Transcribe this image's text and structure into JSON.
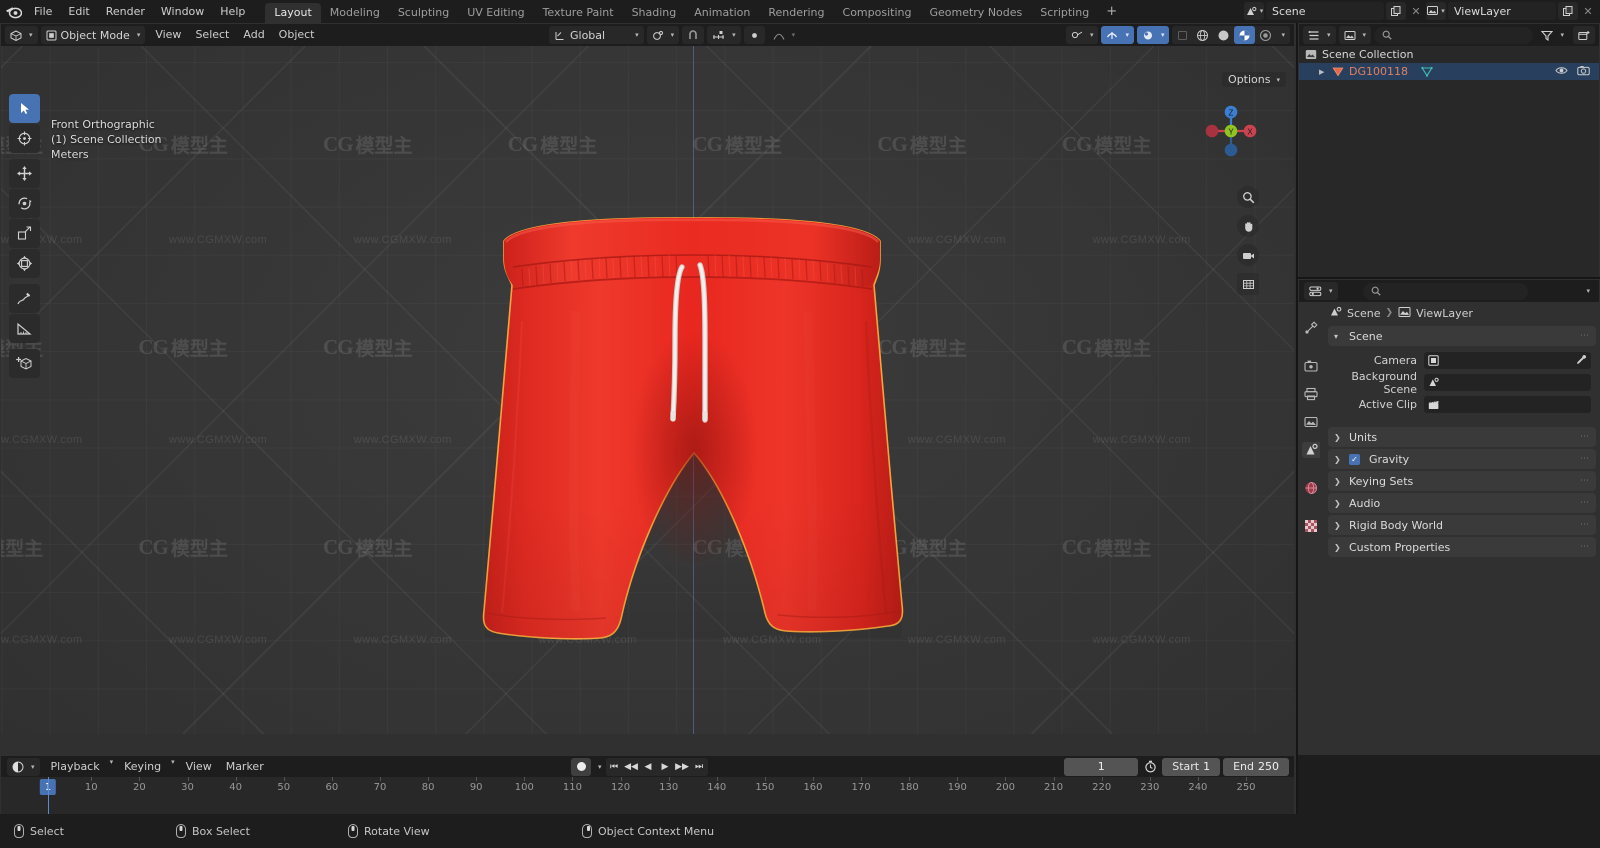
{
  "app": {
    "name": "Blender",
    "logo_icon": "blender-logo-icon"
  },
  "topbar": {
    "menus": [
      "File",
      "Edit",
      "Render",
      "Window",
      "Help"
    ],
    "workspace_tabs": [
      {
        "label": "Layout",
        "active": true
      },
      {
        "label": "Modeling",
        "active": false
      },
      {
        "label": "Sculpting",
        "active": false
      },
      {
        "label": "UV Editing",
        "active": false
      },
      {
        "label": "Texture Paint",
        "active": false
      },
      {
        "label": "Shading",
        "active": false
      },
      {
        "label": "Animation",
        "active": false
      },
      {
        "label": "Rendering",
        "active": false
      },
      {
        "label": "Compositing",
        "active": false
      },
      {
        "label": "Geometry Nodes",
        "active": false
      },
      {
        "label": "Scripting",
        "active": false
      }
    ],
    "add_workspace_label": "+",
    "scene_name": "Scene",
    "viewlayer_name": "ViewLayer",
    "scene_icon": "scene-icon",
    "viewlayer_icon": "viewlayer-icon",
    "new_scene_icon": "duplicate-icon",
    "remove_scene_icon": "close-icon"
  },
  "viewport": {
    "mode": "Object Mode",
    "mode_icon": "object-mode-icon",
    "editor_type_icon": "editor-type-3dview-icon",
    "menus": [
      "View",
      "Select",
      "Add",
      "Object"
    ],
    "transform_orientation": "Global",
    "transform_icon": "transform-orientation-icon",
    "pivot_icon": "pivot-point-icon",
    "snap_icon": "snap-magnet-icon",
    "snap_target_icon": "snap-increment-icon",
    "proportional_icon": "proportional-edit-icon",
    "proportional_falloff_icon": "falloff-curve-icon",
    "options_label": "Options",
    "options_icon": "options-chevron-icon",
    "show_gizmo_icon": "gizmo-icon",
    "overlays_icon": "overlays-icon",
    "xray_icon": "xray-toggle-icon",
    "shading_modes": [
      {
        "name": "wireframe-shading-icon",
        "active": false
      },
      {
        "name": "solid-shading-icon",
        "active": false
      },
      {
        "name": "material-preview-shading-icon",
        "active": true
      },
      {
        "name": "rendered-shading-icon",
        "active": false
      }
    ],
    "overlay_text": {
      "view": "Front Orthographic",
      "collection": "(1) Scene Collection",
      "units": "Meters"
    },
    "tools": [
      {
        "name": "tweak-select-box-tool",
        "icon": "cursor-arrow-icon",
        "active": true
      },
      {
        "name": "cursor-tool",
        "icon": "3d-cursor-icon",
        "active": false
      },
      {
        "name": "move-tool",
        "icon": "move-arrows-icon",
        "active": false
      },
      {
        "name": "rotate-tool",
        "icon": "rotate-icon",
        "active": false
      },
      {
        "name": "scale-tool",
        "icon": "scale-icon",
        "active": false
      },
      {
        "name": "transform-tool",
        "icon": "transform-icon",
        "active": false
      },
      {
        "name": "annotate-tool",
        "icon": "pencil-icon",
        "active": false
      },
      {
        "name": "measure-tool",
        "icon": "ruler-icon",
        "active": false
      },
      {
        "name": "add-cube-tool",
        "icon": "add-cube-icon",
        "active": false
      }
    ],
    "nav_buttons": [
      {
        "name": "zoom-nav-button",
        "icon": "magnifier-icon"
      },
      {
        "name": "pan-nav-button",
        "icon": "hand-icon"
      },
      {
        "name": "camera-view-button",
        "icon": "camera-icon"
      },
      {
        "name": "toggle-ortho-button",
        "icon": "grid-perspective-icon"
      }
    ],
    "gizmo_axes": [
      {
        "label": "Z",
        "color": "#3b7fd4"
      },
      {
        "label": "Y",
        "color": "#8fc521"
      },
      {
        "label": "X",
        "color": "#cc4350"
      }
    ],
    "model": {
      "name": "red athletic shorts",
      "body_color": "#e42a22",
      "body_shadow": "#b71d17",
      "highlight_color": "#f04a3c",
      "outline_color": "#f0a030",
      "drawstring_color": "#e8e4e0"
    },
    "watermarks": {
      "url": "www.CGMXW.com",
      "logo_latin": "CG",
      "logo_cn": "模型主"
    }
  },
  "timeline": {
    "editor_icon": "timeline-editor-icon",
    "menus": [
      "Playback",
      "Keying",
      "View",
      "Marker"
    ],
    "record_icon": "auto-keying-record-icon",
    "playback_controls": [
      {
        "name": "jump-to-start-button",
        "icon": "⏮"
      },
      {
        "name": "jump-to-prev-keyframe-button",
        "icon": "◀◀"
      },
      {
        "name": "play-reverse-button",
        "icon": "◀"
      },
      {
        "name": "play-button",
        "icon": "▶"
      },
      {
        "name": "jump-to-next-keyframe-button",
        "icon": "▶▶"
      },
      {
        "name": "jump-to-end-button",
        "icon": "⏭"
      }
    ],
    "current_frame": "1",
    "frame_icon": "stopwatch-icon",
    "start_label": "Start",
    "start_value": "1",
    "end_label": "End",
    "end_value": "250",
    "ruler_ticks": [
      "1",
      "10",
      "20",
      "30",
      "40",
      "50",
      "60",
      "70",
      "80",
      "90",
      "100",
      "110",
      "120",
      "130",
      "140",
      "150",
      "160",
      "170",
      "180",
      "190",
      "200",
      "210",
      "220",
      "230",
      "240",
      "250"
    ],
    "playhead_frame": "1"
  },
  "outliner": {
    "display_mode_icon": "outliner-display-mode-icon",
    "filter_id_icon": "outliner-id-type-icon",
    "search_icon": "search-icon",
    "search_placeholder": "",
    "filter_icon": "funnel-filter-icon",
    "new_collection_icon": "new-collection-icon",
    "rows": [
      {
        "label": "Scene Collection",
        "icon": "scene-collection-icon",
        "type": "collection",
        "indent": 0,
        "selected": false,
        "expand": ""
      },
      {
        "label": "DG100118",
        "icon": "mesh-object-icon",
        "data_icon": "mesh-data-icon",
        "type": "object",
        "indent": 1,
        "selected": true,
        "expand": "▶",
        "visibility_icon": "eye-icon",
        "render_icon": "camera-render-icon"
      }
    ]
  },
  "properties": {
    "editor_icon": "properties-editor-icon",
    "search_icon": "search-icon",
    "search_placeholder": "",
    "options_icon": "chevron-down-icon",
    "breadcrumb": [
      "Scene",
      "ViewLayer"
    ],
    "breadcrumb_icons": [
      "scene-icon",
      "viewlayer-icon"
    ],
    "tabs": [
      {
        "name": "tool-tab",
        "icon": "tool-icon",
        "active": false
      },
      {
        "name": "render-tab",
        "icon": "camera-back-icon",
        "active": false
      },
      {
        "name": "output-tab",
        "icon": "printer-icon",
        "active": false
      },
      {
        "name": "viewlayer-tab",
        "icon": "images-icon",
        "active": false
      },
      {
        "name": "scene-tab",
        "icon": "scene-cone-icon",
        "active": true
      },
      {
        "name": "world-tab",
        "icon": "world-globe-icon",
        "active": false
      },
      {
        "name": "texture-tab",
        "icon": "checker-texture-icon",
        "active": false
      }
    ],
    "panels": [
      {
        "label": "Scene",
        "expanded": true,
        "rows": [
          {
            "label": "Camera",
            "value": "",
            "icon": "camera-field-icon",
            "eyedropper": true
          },
          {
            "label": "Background Scene",
            "value": "",
            "icon": "scene-field-icon",
            "eyedropper": false
          },
          {
            "label": "Active Clip",
            "value": "",
            "icon": "clapperboard-icon",
            "eyedropper": false
          }
        ]
      },
      {
        "label": "Units",
        "expanded": false,
        "rows": []
      },
      {
        "label": "Gravity",
        "expanded": false,
        "checkbox": true,
        "checked": true,
        "rows": []
      },
      {
        "label": "Keying Sets",
        "expanded": false,
        "rows": []
      },
      {
        "label": "Audio",
        "expanded": false,
        "rows": []
      },
      {
        "label": "Rigid Body World",
        "expanded": false,
        "rows": []
      },
      {
        "label": "Custom Properties",
        "expanded": false,
        "rows": []
      }
    ]
  },
  "statusbar": {
    "items": [
      {
        "label": "Select",
        "icon": "mouse-left-icon"
      },
      {
        "label": "Box Select",
        "icon": "mouse-left-drag-icon"
      },
      {
        "label": "Rotate View",
        "icon": "mouse-middle-icon"
      },
      {
        "label": "Object Context Menu",
        "icon": "mouse-right-icon"
      }
    ]
  },
  "colors": {
    "accent": "#4772b3",
    "panel_bg": "#303030",
    "header_bg": "#1d1d1d",
    "field_bg": "#232323",
    "viewport_bg": "#393939",
    "selected_row": "#28405e",
    "object_text": "#e08060"
  }
}
